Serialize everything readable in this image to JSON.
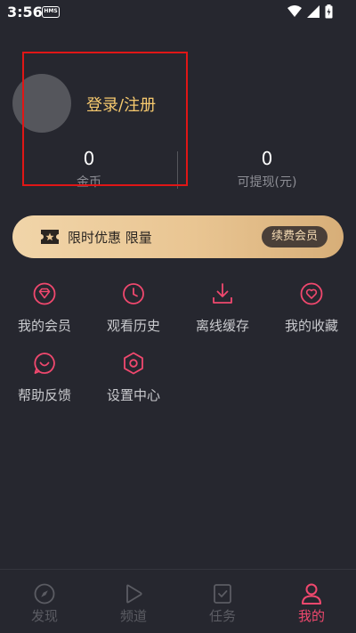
{
  "status_bar": {
    "time": "3:56",
    "badge": "HMS"
  },
  "profile": {
    "login_label": "登录/注册"
  },
  "stats": [
    {
      "value": "0",
      "label": "金币"
    },
    {
      "value": "0",
      "label": "可提现(元)"
    }
  ],
  "vip_banner": {
    "text": "限时优惠 限量",
    "button_label": "续费会员"
  },
  "grid": [
    {
      "label": "我的会员",
      "icon": "diamond-icon"
    },
    {
      "label": "观看历史",
      "icon": "clock-icon"
    },
    {
      "label": "离线缓存",
      "icon": "download-icon"
    },
    {
      "label": "我的收藏",
      "icon": "heart-icon"
    },
    {
      "label": "帮助反馈",
      "icon": "smile-chat-icon"
    },
    {
      "label": "设置中心",
      "icon": "gear-hexagon-icon"
    }
  ],
  "bottom_nav": [
    {
      "label": "发现",
      "icon": "compass-icon",
      "active": false
    },
    {
      "label": "频道",
      "icon": "play-icon",
      "active": false
    },
    {
      "label": "任务",
      "icon": "task-check-icon",
      "active": false
    },
    {
      "label": "我的",
      "icon": "user-icon",
      "active": true
    }
  ],
  "colors": {
    "background": "#26272f",
    "accent": "#f0486e",
    "login_text": "#f6c96e",
    "highlight_box": "#e01616",
    "banner_gold": "#e9c592"
  }
}
